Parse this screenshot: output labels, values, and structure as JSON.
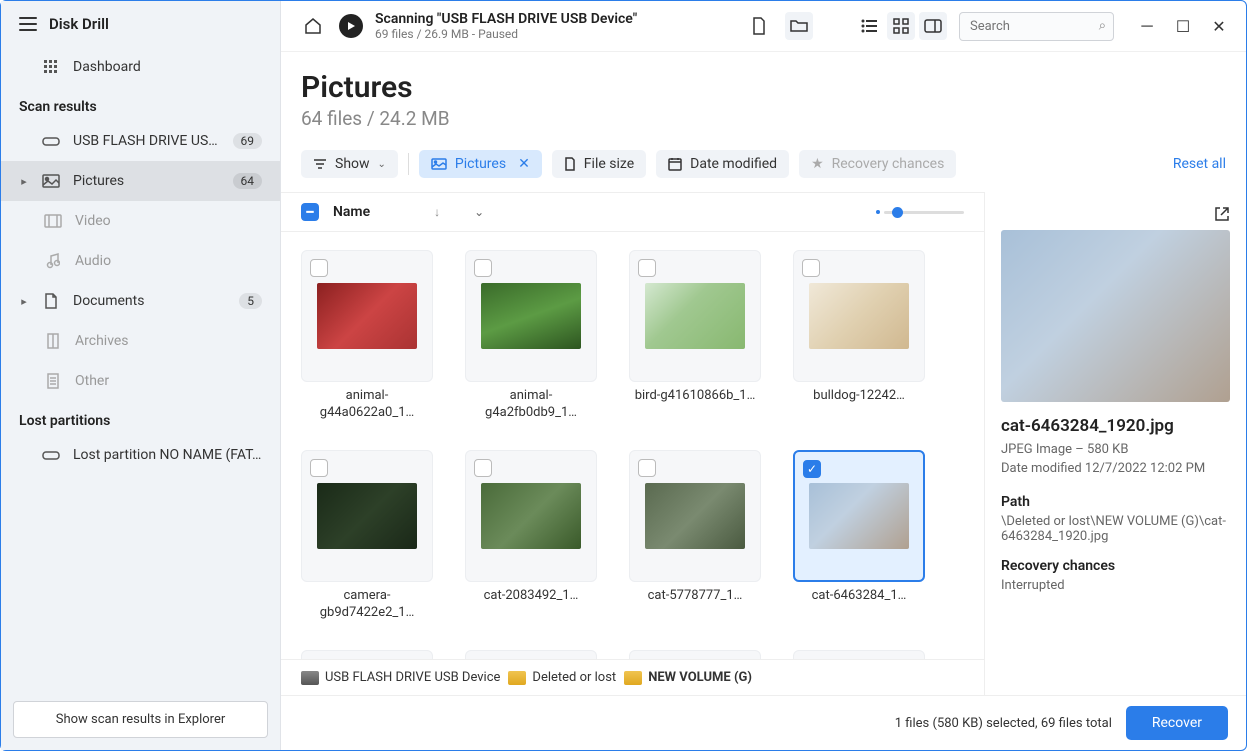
{
  "app_name": "Disk Drill",
  "sidebar": {
    "dashboard": "Dashboard",
    "section_scan": "Scan results",
    "drive": {
      "label": "USB FLASH DRIVE USB D…",
      "badge": "69"
    },
    "pictures": {
      "label": "Pictures",
      "badge": "64"
    },
    "video": "Video",
    "audio": "Audio",
    "documents": {
      "label": "Documents",
      "badge": "5"
    },
    "archives": "Archives",
    "other": "Other",
    "section_lost": "Lost partitions",
    "lost_partition": "Lost partition NO NAME (FAT…",
    "explorer_btn": "Show scan results in Explorer"
  },
  "toolbar": {
    "scan_title": "Scanning \"USB FLASH DRIVE USB Device\"",
    "scan_sub": "69 files / 26.9 MB - Paused",
    "search_placeholder": "Search"
  },
  "page": {
    "title": "Pictures",
    "sub": "64 files / 24.2 MB"
  },
  "filters": {
    "show": "Show",
    "pictures": "Pictures",
    "filesize": "File size",
    "date": "Date modified",
    "recovery": "Recovery chances",
    "reset": "Reset all"
  },
  "columns": {
    "name": "Name"
  },
  "files": [
    {
      "name": "animal-g44a0622a0_1…",
      "thumb": "t-red",
      "selected": false
    },
    {
      "name": "animal-g4a2fb0db9_1…",
      "thumb": "t-green1",
      "selected": false
    },
    {
      "name": "bird-g41610866b_1…",
      "thumb": "t-bird",
      "selected": false
    },
    {
      "name": "bulldog-12242…",
      "thumb": "t-dog",
      "selected": false
    },
    {
      "name": "camera-gb9d7422e2_1…",
      "thumb": "t-camera",
      "selected": false
    },
    {
      "name": "cat-2083492_1…",
      "thumb": "t-cat1",
      "selected": false
    },
    {
      "name": "cat-5778777_1…",
      "thumb": "t-cat2",
      "selected": false
    },
    {
      "name": "cat-6463284_1…",
      "thumb": "t-cat3",
      "selected": true
    }
  ],
  "breadcrumb": {
    "a": "USB FLASH DRIVE USB Device",
    "b": "Deleted or lost",
    "c": "NEW VOLUME (G)"
  },
  "details": {
    "filename": "cat-6463284_1920.jpg",
    "meta1": "JPEG Image – 580 KB",
    "meta2": "Date modified 12/7/2022 12:02 PM",
    "path_h": "Path",
    "path": "\\Deleted or lost\\NEW VOLUME (G)\\cat-6463284_1920.jpg",
    "rec_h": "Recovery chances",
    "rec": "Interrupted"
  },
  "status": {
    "text": "1 files (580 KB) selected, 69 files total",
    "recover": "Recover"
  }
}
